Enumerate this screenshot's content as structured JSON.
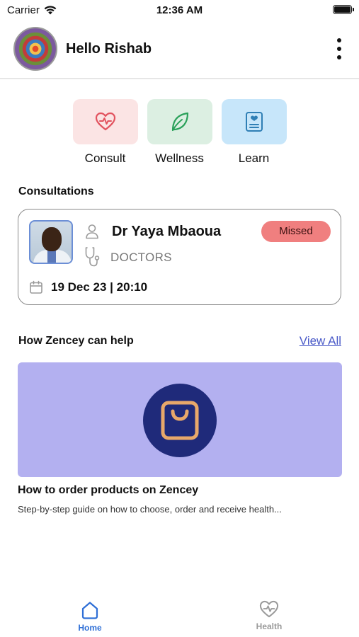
{
  "status_bar": {
    "carrier": "Carrier",
    "time": "12:36 AM",
    "battery_level": 1.0
  },
  "header": {
    "greeting": "Hello Rishab",
    "avatar_icon": "avatar-image",
    "menu_icon": "more-vertical-icon"
  },
  "quick_actions": [
    {
      "label": "Consult",
      "icon": "heart-pulse-icon",
      "bg": "#fbe4e4",
      "color": "#e2535f"
    },
    {
      "label": "Wellness",
      "icon": "leaf-icon",
      "bg": "#dcefe2",
      "color": "#2aa15a"
    },
    {
      "label": "Learn",
      "icon": "book-icon",
      "bg": "#c7e6fa",
      "color": "#2f7fb5"
    }
  ],
  "consultations": {
    "title": "Consultations",
    "card": {
      "doctor_name": "Dr Yaya Mbaoua",
      "role": "DOCTORS",
      "status": "Missed",
      "status_color": "#f07f7f",
      "datetime": "19 Dec 23 | 20:10"
    }
  },
  "help": {
    "title": "How Zencey can help",
    "view_all": "View All",
    "article": {
      "title": "How to order products on Zencey",
      "description": "Step-by-step guide on how to choose, order and receive health...",
      "banner_bg": "#b3b0f0",
      "icon": "shopping-bag-icon"
    }
  },
  "tabs": [
    {
      "label": "Home",
      "icon": "home-icon",
      "active": true,
      "color": "#2f6fd6"
    },
    {
      "label": "Health",
      "icon": "heart-pulse-icon",
      "active": false,
      "color": "#9a9a9a"
    }
  ]
}
